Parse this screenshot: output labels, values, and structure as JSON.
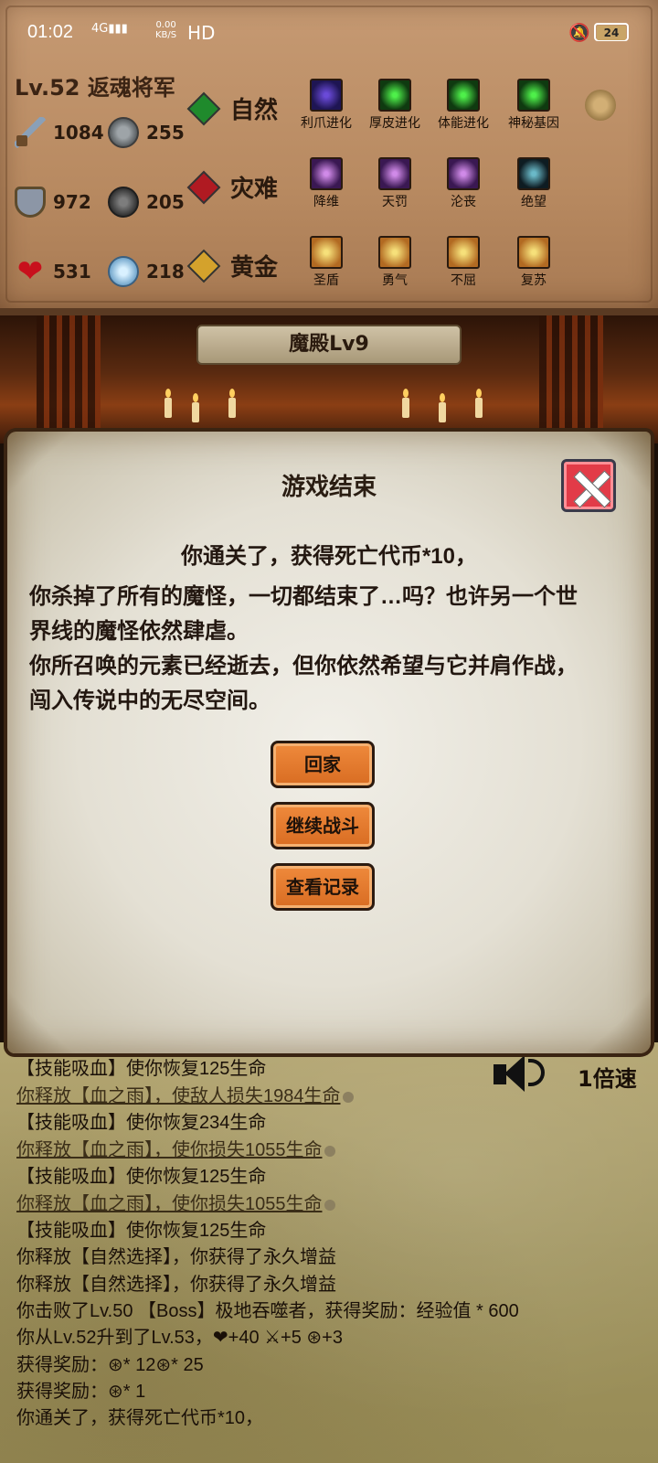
{
  "status_bar": {
    "time": "01:02",
    "signal": "4G",
    "net_speed_top": "0.00",
    "net_speed_bottom": "KB/S",
    "hd": "HD",
    "battery": "24"
  },
  "player": {
    "level_name": "Lv.52 返魂将军"
  },
  "stats": {
    "attack": "1084",
    "coin1": "255",
    "defense": "972",
    "coin2": "205",
    "hp": "531",
    "coin3": "218"
  },
  "elements": [
    {
      "name": "自然",
      "color": "#1f8a2c",
      "skills": [
        "利爪进化",
        "厚皮进化",
        "体能进化",
        "神秘基因"
      ]
    },
    {
      "name": "灾难",
      "color": "#b01a22",
      "skills": [
        "降维",
        "天罚",
        "沦丧",
        "绝望"
      ]
    },
    {
      "name": "黄金",
      "color": "#d4a22c",
      "skills": [
        "圣盾",
        "勇气",
        "不屈",
        "复苏"
      ]
    }
  ],
  "scene": {
    "banner": "魔殿Lv9"
  },
  "dialog": {
    "title": "游戏结束",
    "lines": [
      "你通关了，获得死亡代币*10，",
      "你杀掉了所有的魔怪，一切都结束了…吗？也许另一个世",
      "界线的魔怪依然肆虐。",
      "你所召唤的元素已经逝去，但你依然希望与它并肩作战，",
      "闯入传说中的无尽空间。"
    ],
    "buttons": {
      "home": "回家",
      "continue": "继续战斗",
      "records": "查看记录"
    }
  },
  "log": {
    "speed": "1倍速",
    "lines": [
      "【技能吸血】使你恢复125生命",
      "你释放【血之雨】，使敌人损失1984生命",
      "【技能吸血】使你恢复234生命",
      "你释放【血之雨】，使你损失1055生命",
      "【技能吸血】使你恢复125生命",
      "你释放【血之雨】，使你损失1055生命",
      "【技能吸血】使你恢复125生命",
      "你释放【自然选择】，你获得了永久增益",
      "你释放【自然选择】，你获得了永久增益",
      "你击败了Lv.50 【Boss】极地吞噬者，获得奖励：经验值 * 600",
      "你从Lv.52升到了Lv.53，❤+40 ⚔+5 ⊛+3",
      "获得奖励：⊛* 12⊛* 25",
      "获得奖励：⊛* 1",
      "你通关了，获得死亡代币*10，"
    ]
  }
}
